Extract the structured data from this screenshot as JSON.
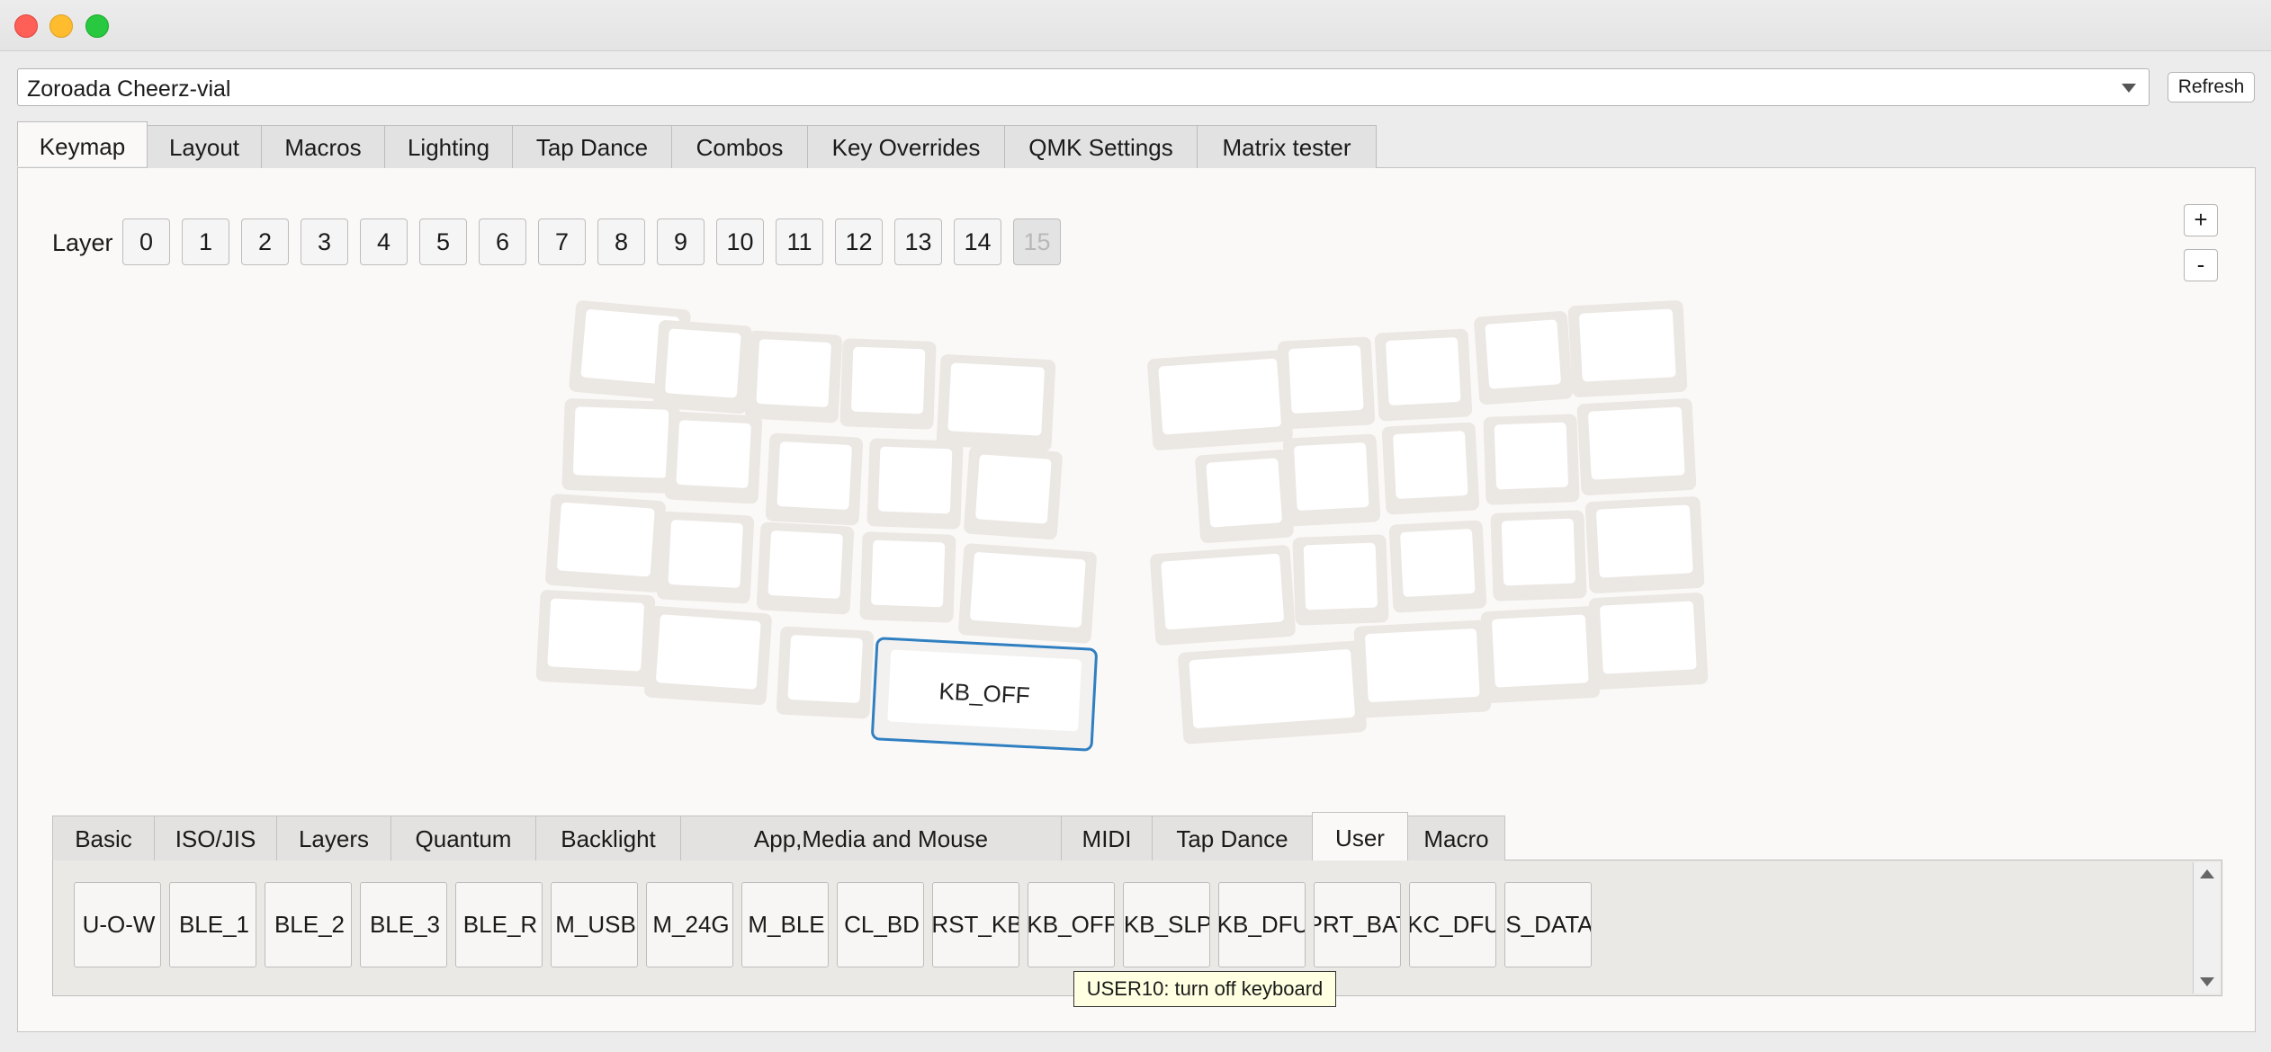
{
  "device": {
    "selected": "Zoroada Cheerz-vial",
    "refresh_label": "Refresh"
  },
  "main_tabs": [
    "Keymap",
    "Layout",
    "Macros",
    "Lighting",
    "Tap Dance",
    "Combos",
    "Key Overrides",
    "QMK Settings",
    "Matrix tester"
  ],
  "main_tab_active": "Keymap",
  "layer": {
    "label": "Layer",
    "buttons": [
      "0",
      "1",
      "2",
      "3",
      "4",
      "5",
      "6",
      "7",
      "8",
      "9",
      "10",
      "11",
      "12",
      "13",
      "14",
      "15"
    ],
    "disabled": "15"
  },
  "zoom": {
    "plus": "+",
    "minus": "-"
  },
  "selected_key": {
    "label": "KB_OFF"
  },
  "key_tabs": [
    "Basic",
    "ISO/JIS",
    "Layers",
    "Quantum",
    "Backlight",
    "App,Media and Mouse",
    "MIDI",
    "Tap Dance",
    "User",
    "Macro"
  ],
  "key_tab_active": "User",
  "user_keys": [
    "U-O-W",
    "BLE_1",
    "BLE_2",
    "BLE_3",
    "BLE_R",
    "M_USB",
    "M_24G",
    "M_BLE",
    "CL_BD",
    "RST_KB",
    "KB_OFF",
    "KB_SLP",
    "KB_DFU",
    "PRT_BAT",
    "KC_DFU",
    "S_DATA"
  ],
  "tooltip": "USER10: turn off keyboard",
  "colors": {
    "selection_blue": "#2f7fc1",
    "panel_bg": "#fbf9f8",
    "keycap_base": "#ebe7e3"
  }
}
